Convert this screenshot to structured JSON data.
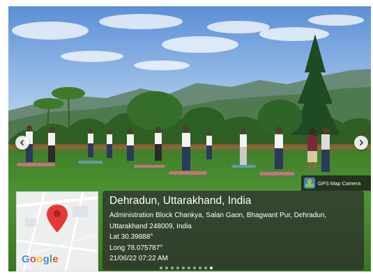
{
  "photo": {
    "description_icon": "photo-icon",
    "badge_text": "GPS Map Camera",
    "badge_icon": "gps-map-camera-icon"
  },
  "location": {
    "title": "Dehradun, Uttarakhand, India",
    "address_line_1": "Administration Block Chankya, Salan Gaon, Bhagwant Pur, Dehradun,",
    "address_line_2": "Uttarakhand 248009, India",
    "latitude": "Lat 30.39888°",
    "longitude": "Long 78.075787°",
    "datetime": "21/06/22 07:22 AM"
  },
  "map": {
    "brand": "Google",
    "pin_icon": "map-pin-icon"
  },
  "navigation": {
    "prev_icon": "chevron-left-icon",
    "next_icon": "chevron-right-icon",
    "dot_count": 10,
    "active_dot": 9
  },
  "colors": {
    "sky": "#6f9fd8",
    "grass": "#4a8a2e",
    "panel": "#2d2d2d",
    "pin": "#e53935"
  }
}
